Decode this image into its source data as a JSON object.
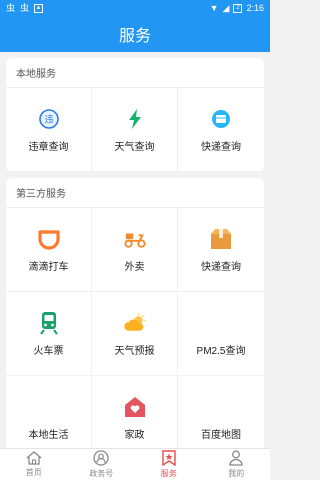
{
  "status": {
    "time": "2:16",
    "icons": [
      "bug-icon",
      "bug-icon",
      "download-box-icon"
    ],
    "right_icons": [
      "wifi-icon",
      "signal-icon",
      "battery-icon"
    ],
    "badge": "2"
  },
  "header": {
    "title": "服务"
  },
  "sections": [
    {
      "title": "本地服务",
      "items": [
        {
          "label": "违章查询",
          "icon": "violation-icon"
        },
        {
          "label": "天气查询",
          "icon": "lightning-icon"
        },
        {
          "label": "快递查询",
          "icon": "express-icon"
        }
      ]
    },
    {
      "title": "第三方服务",
      "items": [
        {
          "label": "滴滴打车",
          "icon": "didi-icon"
        },
        {
          "label": "外卖",
          "icon": "scooter-icon"
        },
        {
          "label": "快递查询",
          "icon": "package-icon"
        },
        {
          "label": "火车票",
          "icon": "train-icon"
        },
        {
          "label": "天气预报",
          "icon": "weather-icon"
        },
        {
          "label": "PM2.5查询",
          "icon": ""
        },
        {
          "label": "本地生活",
          "icon": ""
        },
        {
          "label": "家政",
          "icon": "house-heart-icon"
        },
        {
          "label": "百度地图",
          "icon": ""
        }
      ]
    }
  ],
  "tabs": [
    {
      "label": "首页",
      "icon": "home-icon",
      "active": false
    },
    {
      "label": "政务号",
      "icon": "profile-badge-icon",
      "active": false
    },
    {
      "label": "服务",
      "icon": "bookmark-star-icon",
      "active": true
    },
    {
      "label": "我的",
      "icon": "person-icon",
      "active": false
    }
  ],
  "colors": {
    "primary": "#2196f3",
    "active_tab": "#e84c4c",
    "didi": "#ff7a2e",
    "weather": "#ffb020",
    "train": "#1aa16b",
    "package": "#e89a3c",
    "lightning": "#16b36a",
    "house": "#e2555f"
  }
}
